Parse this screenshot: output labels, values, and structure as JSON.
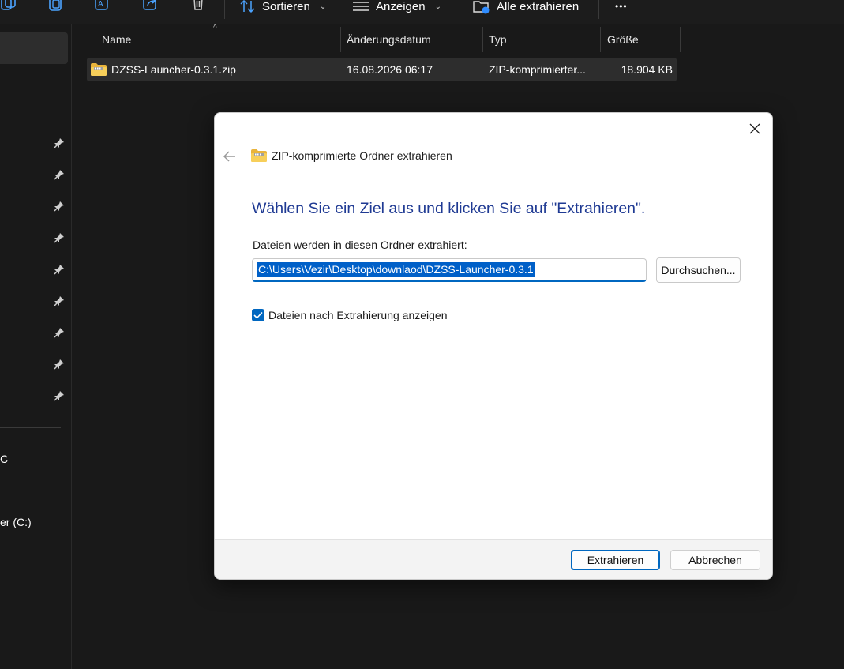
{
  "toolbar": {
    "sort_label": "Sortieren",
    "view_label": "Anzeigen",
    "extract_all_label": "Alle extrahieren",
    "more_label": "•••"
  },
  "sidebar": {
    "partial_item_1": "C",
    "partial_item_2": "er (C:)"
  },
  "file_list": {
    "columns": [
      "Name",
      "Änderungsdatum",
      "Typ",
      "Größe"
    ],
    "rows": [
      {
        "name": "DZSS-Launcher-0.3.1.zip",
        "date": "16.08.2026 06:17",
        "type": "ZIP-komprimierter...",
        "size": "18.904 KB"
      }
    ]
  },
  "dialog": {
    "title": "ZIP-komprimierte Ordner extrahieren",
    "heading": "Wählen Sie ein Ziel aus und klicken Sie auf \"Extrahieren\".",
    "path_label": "Dateien werden in diesen Ordner extrahiert:",
    "path_value": "C:\\Users\\Vezir\\Desktop\\downlaod\\DZSS-Launcher-0.3.1",
    "browse_label": "Durchsuchen...",
    "show_after_label": "Dateien nach Extrahierung anzeigen",
    "show_after_checked": true,
    "extract_label": "Extrahieren",
    "cancel_label": "Abbrechen"
  },
  "colors": {
    "accent": "#0067c0",
    "heading": "#1f3a93",
    "dark_bg": "#191919",
    "selected_row": "#2d2d2d"
  }
}
